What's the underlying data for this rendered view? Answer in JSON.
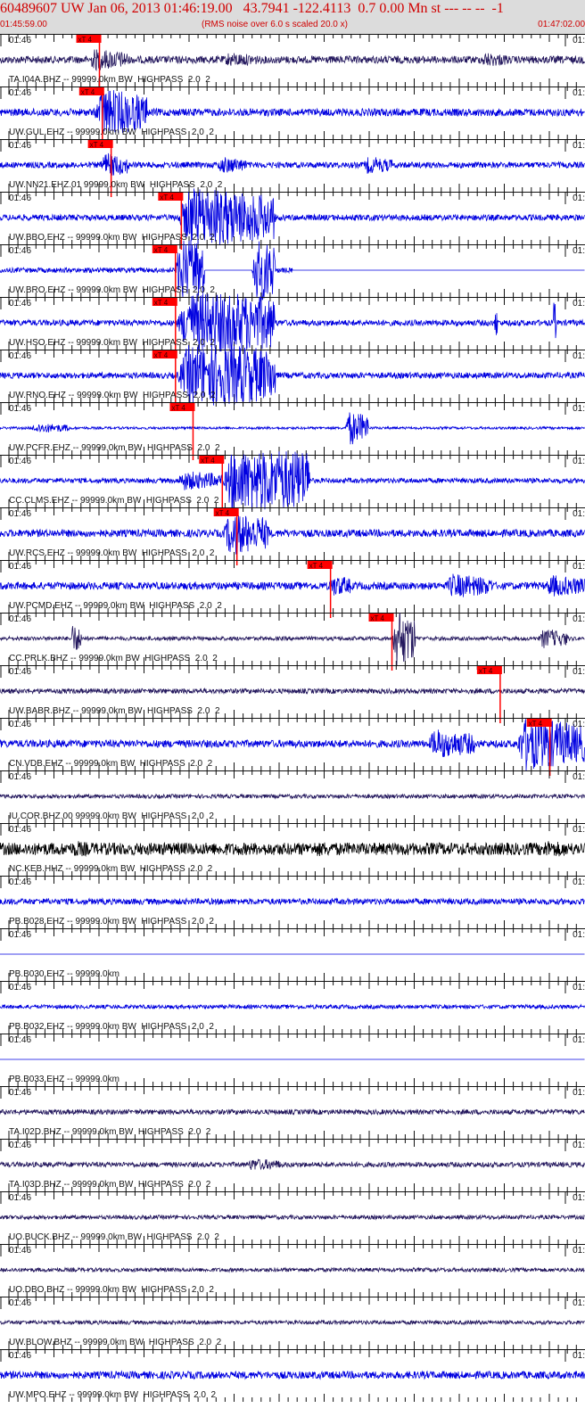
{
  "header": {
    "title": "60489607 UW Jan 06, 2013 01:46:19.00   43.7941 -122.4113  0.7 0.00 Mn st --- -- --  -1",
    "start_time": "01:45:59.00",
    "rms_note": "(RMS noise over 6.0 s scaled 20.0 x)",
    "end_time": "01:47:02.00"
  },
  "colors": {
    "header_bg": "#dcdcdc",
    "header_text": "#d00000",
    "trace_blue": "#0000e0",
    "trace_navy": "#24185e",
    "trace_black": "#000000",
    "pick_red": "#ff0000",
    "axis": "#111111"
  },
  "pick_label": "xT 4",
  "minute_label_left": "01:46",
  "minute_label_right": "01:",
  "traces": [
    {
      "channel": "TA.I04A.BHZ -- 99999.0km BW  HIGHPASS  2.0  2",
      "color": "navy",
      "amp": 0.15,
      "pick": 0.17,
      "bursts": [
        [
          0.15,
          0.22,
          0.45
        ],
        [
          0.38,
          0.44,
          0.3
        ],
        [
          0.82,
          0.87,
          0.3
        ]
      ],
      "flat": []
    },
    {
      "channel": "UW.GUL.EHZ -- 99999.0km BW  HIGHPASS  2.0  2",
      "color": "blue",
      "amp": 0.15,
      "pick": 0.175,
      "bursts": [
        [
          0.16,
          0.25,
          1.0
        ]
      ],
      "flat": []
    },
    {
      "channel": "UW.NN21.EHZ.01 99999.0km BW  HIGHPASS  2.0  2",
      "color": "blue",
      "amp": 0.12,
      "pick": 0.19,
      "bursts": [
        [
          0.17,
          0.22,
          0.5
        ],
        [
          0.37,
          0.42,
          0.35
        ],
        [
          0.62,
          0.67,
          0.35
        ]
      ],
      "flat": []
    },
    {
      "channel": "UW.BBO.EHZ -- 99999.0km BW  HIGHPASS  2.0  2",
      "color": "blue",
      "amp": 0.12,
      "pick": 0.31,
      "bursts": [
        [
          0.3,
          0.47,
          1.3
        ]
      ],
      "flat": []
    },
    {
      "channel": "UW.BRO.EHZ -- 99999.0km BW  HIGHPASS  2.0  2",
      "color": "blue",
      "amp": 0.1,
      "pick": 0.3,
      "bursts": [
        [
          0.3,
          0.35,
          1.6
        ],
        [
          0.43,
          0.47,
          1.6
        ]
      ],
      "flat": [
        [
          0.35,
          0.43
        ],
        [
          0.5,
          1.0
        ]
      ]
    },
    {
      "channel": "UW.HSO.EHZ -- 99999.0km BW  HIGHPASS  2.0  2",
      "color": "blue",
      "amp": 0.12,
      "pick": 0.3,
      "bursts": [
        [
          0.3,
          0.47,
          1.5
        ],
        [
          0.845,
          0.85,
          0.9
        ],
        [
          0.945,
          0.95,
          1.0
        ]
      ],
      "flat": []
    },
    {
      "channel": "UW.RNO.EHZ -- 99999.0km BW  HIGHPASS  2.0  2",
      "color": "blue",
      "amp": 0.12,
      "pick": 0.3,
      "bursts": [
        [
          0.3,
          0.47,
          1.5
        ]
      ],
      "flat": []
    },
    {
      "channel": "UW.PCFR.EHZ -- 99999.0km BW  HIGHPASS  2.0  2",
      "color": "blue",
      "amp": 0.05,
      "pick": 0.33,
      "bursts": [
        [
          0.05,
          0.12,
          0.2
        ],
        [
          0.59,
          0.63,
          0.7
        ]
      ],
      "flat": []
    },
    {
      "channel": "CC.CLMS.EHZ -- 99999.0km BW  HIGHPASS  2.0  2",
      "color": "blue",
      "amp": 0.1,
      "pick": 0.38,
      "bursts": [
        [
          0.38,
          0.53,
          1.8
        ],
        [
          0.3,
          0.38,
          0.4
        ]
      ],
      "flat": []
    },
    {
      "channel": "UW.RCS.EHZ -- 99999.0km BW  HIGHPASS  2.0  2",
      "color": "blue",
      "amp": 0.15,
      "pick": 0.405,
      "bursts": [
        [
          0.38,
          0.46,
          0.9
        ]
      ],
      "flat": []
    },
    {
      "channel": "UW.PCMD.EHZ -- 99999.0km BW  HIGHPASS  2.0  2",
      "color": "blue",
      "amp": 0.15,
      "pick": 0.565,
      "bursts": [
        [
          0.56,
          0.6,
          0.45
        ],
        [
          0.76,
          0.84,
          0.5
        ],
        [
          0.93,
          1.0,
          0.45
        ]
      ],
      "flat": []
    },
    {
      "channel": "CC.PRLK.BHZ -- 99999.0km BW  HIGHPASS  2.0  2",
      "color": "navy",
      "amp": 0.08,
      "pick": 0.67,
      "bursts": [
        [
          0.12,
          0.14,
          0.6
        ],
        [
          0.67,
          0.71,
          1.2
        ],
        [
          0.92,
          0.97,
          0.4
        ]
      ],
      "flat": []
    },
    {
      "channel": "UW.BABR.BHZ -- 99999.0km BW  HIGHPASS  2.0  2",
      "color": "navy",
      "amp": 0.1,
      "pick": 0.855,
      "bursts": [],
      "flat": []
    },
    {
      "channel": "CN.VDB.EHZ -- 99999.0km BW  HIGHPASS  2.0  2",
      "color": "blue",
      "amp": 0.15,
      "pick": 0.94,
      "bursts": [
        [
          0.73,
          0.81,
          0.6
        ],
        [
          0.88,
          1.0,
          1.1
        ]
      ],
      "flat": []
    },
    {
      "channel": "IU.COR.BHZ.00 99999.0km BW  HIGHPASS  2.0  2",
      "color": "navy",
      "amp": 0.08,
      "pick": null,
      "bursts": [],
      "flat": []
    },
    {
      "channel": "NC.KEB.HHZ -- 99999.0km BW  HIGHPASS  2.0  2",
      "color": "black",
      "amp": 0.25,
      "pick": null,
      "bursts": [
        [
          0.12,
          0.16,
          0.35
        ],
        [
          0.52,
          0.64,
          0.3
        ],
        [
          0.92,
          0.99,
          0.35
        ]
      ],
      "flat": []
    },
    {
      "channel": "PB.B028.EHZ -- 99999.0km BW  HIGHPASS  2.0  2",
      "color": "blue",
      "amp": 0.12,
      "pick": null,
      "bursts": [],
      "flat": []
    },
    {
      "channel": "PB.B030.EHZ -- 99999.0km",
      "color": "blue",
      "amp": 0.0,
      "pick": null,
      "bursts": [],
      "flat": []
    },
    {
      "channel": "PB.B032.EHZ -- 99999.0km BW  HIGHPASS  2.0  2",
      "color": "blue",
      "amp": 0.08,
      "pick": null,
      "bursts": [],
      "flat": []
    },
    {
      "channel": "PB.B033.EHZ -- 99999.0km",
      "color": "blue",
      "amp": 0.0,
      "pick": null,
      "bursts": [],
      "flat": []
    },
    {
      "channel": "TA.I02D.BHZ -- 99999.0km BW  HIGHPASS  2.0  2",
      "color": "navy",
      "amp": 0.1,
      "pick": null,
      "bursts": [],
      "flat": []
    },
    {
      "channel": "TA.I03D.BHZ -- 99999.0km BW  HIGHPASS  2.0  2",
      "color": "navy",
      "amp": 0.1,
      "pick": null,
      "bursts": [
        [
          0.42,
          0.48,
          0.25
        ]
      ],
      "flat": []
    },
    {
      "channel": "UO.BUCK.BHZ -- 99999.0km BW  HIGHPASS  2.0  2",
      "color": "navy",
      "amp": 0.08,
      "pick": null,
      "bursts": [],
      "flat": []
    },
    {
      "channel": "UO.DBO.BHZ -- 99999.0km BW  HIGHPASS  2.0  2",
      "color": "navy",
      "amp": 0.08,
      "pick": null,
      "bursts": [],
      "flat": []
    },
    {
      "channel": "UW.BLOW.BHZ -- 99999.0km BW  HIGHPASS  2.0  2",
      "color": "navy",
      "amp": 0.08,
      "pick": null,
      "bursts": [],
      "flat": []
    },
    {
      "channel": "UW.MPO.EHZ -- 99999.0km BW  HIGHPASS  2.0  2",
      "color": "blue",
      "amp": 0.15,
      "pick": null,
      "bursts": [],
      "flat": []
    }
  ]
}
